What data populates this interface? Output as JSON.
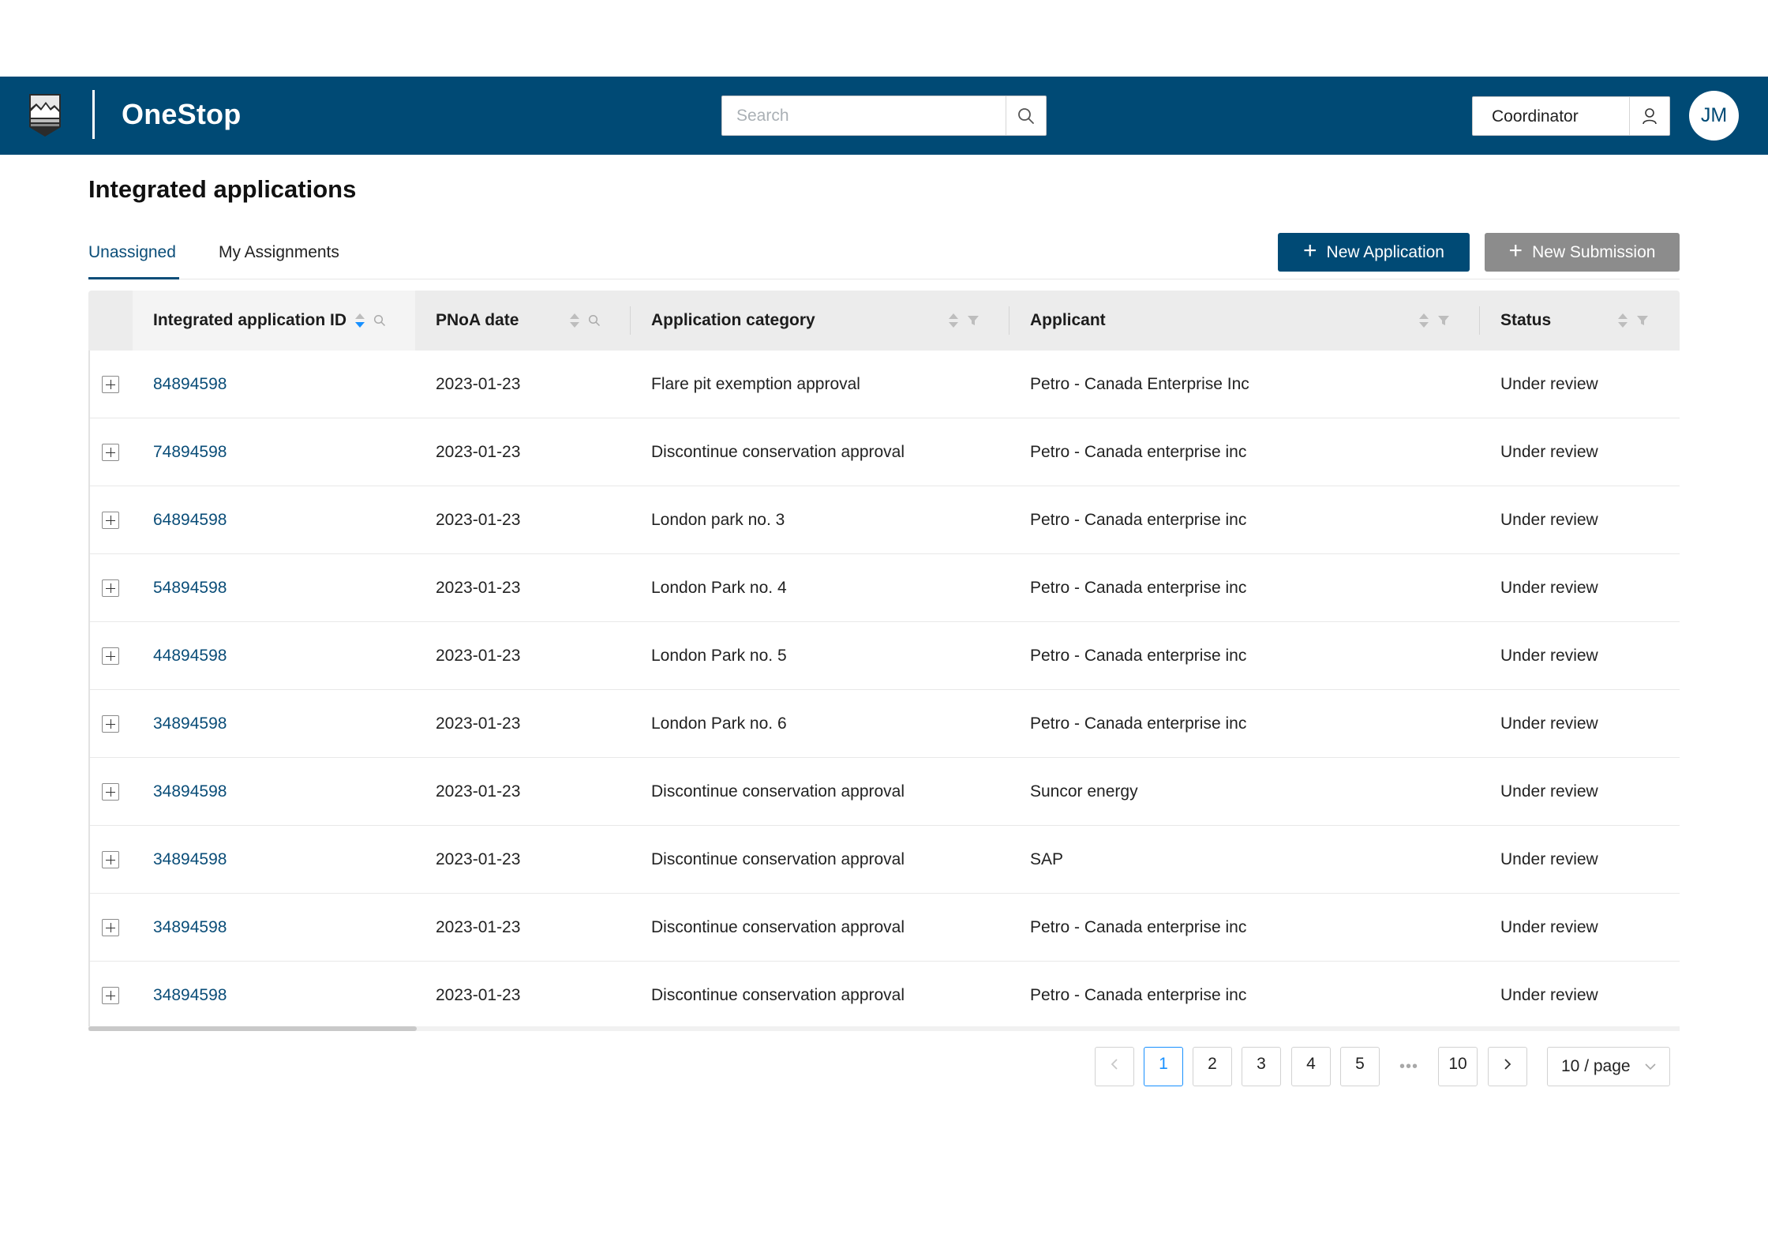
{
  "header": {
    "brand": "OneStop",
    "search_placeholder": "Search",
    "role": "Coordinator",
    "avatar_initials": "JM"
  },
  "page": {
    "title": "Integrated applications"
  },
  "tabs": [
    {
      "label": "Unassigned",
      "active": true
    },
    {
      "label": "My Assignments",
      "active": false
    }
  ],
  "actions": {
    "new_application": "New Application",
    "new_submission": "New Submission"
  },
  "table": {
    "columns": [
      {
        "label": "Integrated application ID",
        "icons": [
          "sort",
          "search"
        ],
        "sorted": "desc"
      },
      {
        "label": "PNoA date",
        "icons": [
          "sort",
          "search"
        ]
      },
      {
        "label": "Application category",
        "icons": [
          "sort",
          "filter"
        ]
      },
      {
        "label": "Applicant",
        "icons": [
          "sort",
          "filter"
        ]
      },
      {
        "label": "Status",
        "icons": [
          "sort",
          "filter"
        ]
      }
    ],
    "rows": [
      {
        "id": "84894598",
        "date": "2023-01-23",
        "category": "Flare pit exemption approval",
        "applicant": "Petro - Canada Enterprise Inc",
        "status": "Under review"
      },
      {
        "id": "74894598",
        "date": "2023-01-23",
        "category": "Discontinue conservation approval",
        "applicant": "Petro - Canada enterprise inc",
        "status": "Under review"
      },
      {
        "id": "64894598",
        "date": "2023-01-23",
        "category": "London park no. 3",
        "applicant": "Petro - Canada enterprise inc",
        "status": "Under review"
      },
      {
        "id": "54894598",
        "date": "2023-01-23",
        "category": "London Park no. 4",
        "applicant": "Petro - Canada enterprise inc",
        "status": "Under review"
      },
      {
        "id": "44894598",
        "date": "2023-01-23",
        "category": "London Park no. 5",
        "applicant": "Petro - Canada enterprise inc",
        "status": "Under review"
      },
      {
        "id": "34894598",
        "date": "2023-01-23",
        "category": "London Park no. 6",
        "applicant": "Petro - Canada enterprise inc",
        "status": "Under review"
      },
      {
        "id": "34894598",
        "date": "2023-01-23",
        "category": "Discontinue conservation approval",
        "applicant": "Suncor energy",
        "status": "Under review"
      },
      {
        "id": "34894598",
        "date": "2023-01-23",
        "category": "Discontinue conservation approval",
        "applicant": "SAP",
        "status": "Under review"
      },
      {
        "id": "34894598",
        "date": "2023-01-23",
        "category": "Discontinue conservation approval",
        "applicant": "Petro - Canada enterprise inc",
        "status": "Under review"
      },
      {
        "id": "34894598",
        "date": "2023-01-23",
        "category": "Discontinue conservation approval",
        "applicant": "Petro - Canada enterprise inc",
        "status": "Under review"
      }
    ]
  },
  "pagination": {
    "pages": [
      "1",
      "2",
      "3",
      "4",
      "5"
    ],
    "ellipsis": "•••",
    "last_page": "10",
    "current": "1",
    "page_size": "10 / page"
  },
  "colors": {
    "header_bg": "#004a75",
    "primary": "#004a75",
    "link": "#0a4d78",
    "secondary_button": "#8c8c8c",
    "active_page": "#1890ff"
  }
}
